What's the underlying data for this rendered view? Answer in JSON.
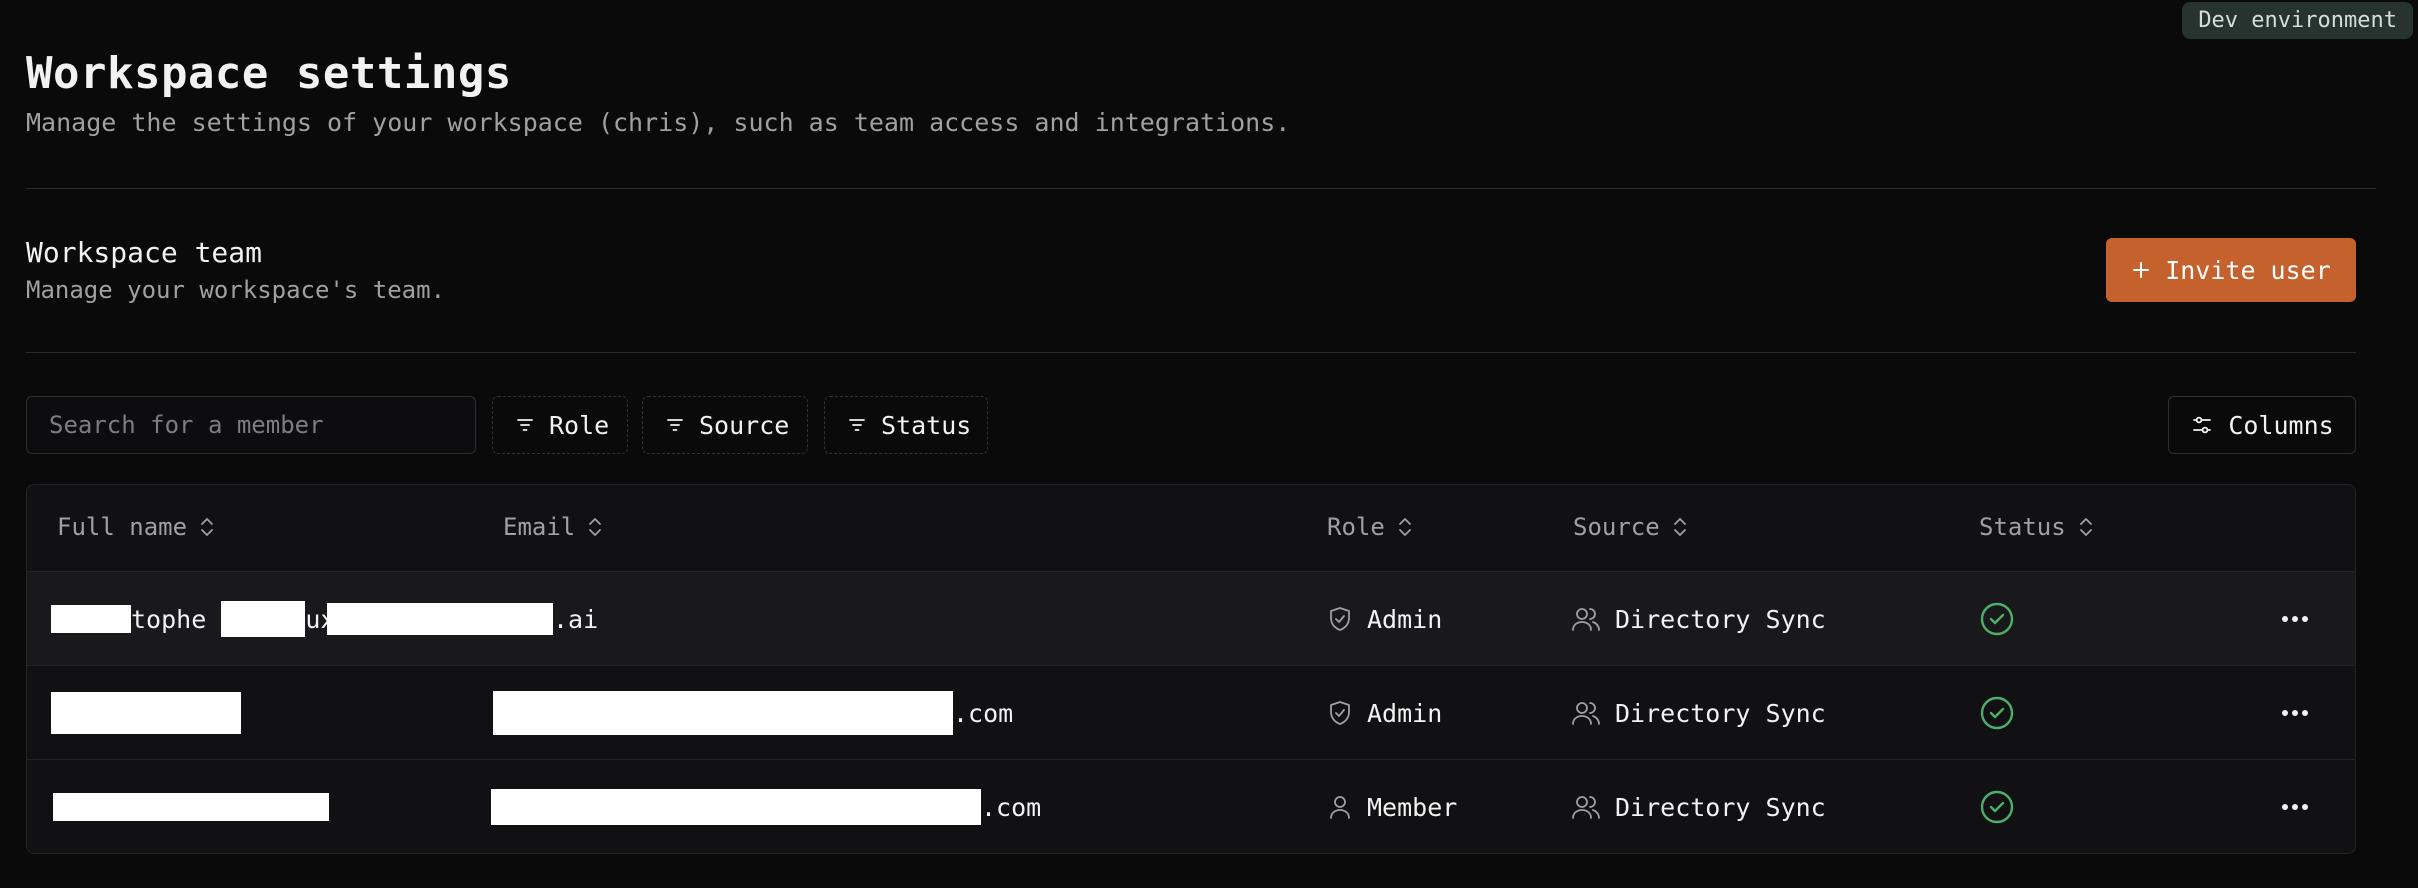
{
  "env_badge": "Dev environment",
  "header": {
    "title": "Workspace settings",
    "subtitle": "Manage the settings of your workspace (chris), such as team access and integrations."
  },
  "team_section": {
    "title": "Workspace team",
    "subtitle": "Manage your workspace's team.",
    "invite_label": "Invite user"
  },
  "toolbar": {
    "search_placeholder": "Search for a member",
    "filters": [
      "Role",
      "Source",
      "Status"
    ],
    "columns_label": "Columns"
  },
  "table": {
    "columns": [
      "Full name",
      "Email",
      "Role",
      "Source",
      "Status"
    ],
    "rows": [
      {
        "name_a": "tophe ",
        "name_b": "ux",
        "email_suffix": ".ai",
        "role": "Admin",
        "role_icon": "shield-icon",
        "source": "Directory Sync",
        "status": "active"
      },
      {
        "name_a": "",
        "name_b": "",
        "email_suffix": ".com",
        "role": "Admin",
        "role_icon": "shield-icon",
        "source": "Directory Sync",
        "status": "active"
      },
      {
        "name_a": "",
        "name_b": "",
        "email_suffix": ".com",
        "role": "Member",
        "role_icon": "user-icon",
        "source": "Directory Sync",
        "status": "active"
      }
    ]
  },
  "colors": {
    "background": "#0a0a0b",
    "accent": "#c4612d",
    "status_ok": "#4caf6a",
    "muted_text": "#a0a0a3"
  }
}
